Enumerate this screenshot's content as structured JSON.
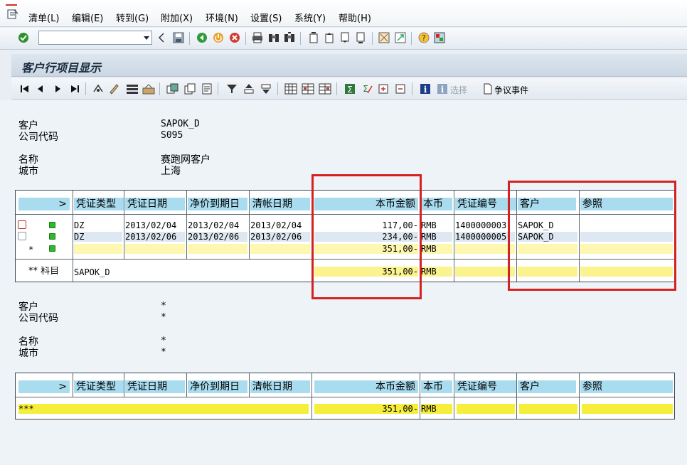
{
  "menu": {
    "items": [
      "清单(L)",
      "编辑(E)",
      "转到(G)",
      "附加(X)",
      "环境(N)",
      "设置(S)",
      "系统(Y)",
      "帮助(H)"
    ]
  },
  "title": "客户行项目显示",
  "app_toolbar": {
    "select_label": "选择",
    "dispute_label": "争议事件"
  },
  "header1": {
    "customer_label": "客户",
    "customer_value": "SAPOK_D",
    "company_label": "公司代码",
    "company_value": "S095",
    "name_label": "名称",
    "name_value": "赛跑网客户",
    "city_label": "城市",
    "city_value": "上海"
  },
  "header2": {
    "customer_label": "客户",
    "customer_value": "*",
    "company_label": "公司代码",
    "company_value": "*",
    "name_label": "名称",
    "name_value": "*",
    "city_label": "城市",
    "city_value": "*"
  },
  "columns": {
    "expand": ">",
    "doc_type": "凭证类型",
    "doc_date": "凭证日期",
    "net_due": "净价到期日",
    "clear_date": "清帐日期",
    "amount": "本币金额",
    "currency": "本币",
    "doc_no": "凭证编号",
    "customer": "客户",
    "reference": "参照"
  },
  "grid1": {
    "rows": [
      {
        "doc_type": "DZ",
        "doc_date": "2013/02/04",
        "net_due": "2013/02/04",
        "clear_date": "2013/02/04",
        "amount": "117,00-",
        "currency": "RMB",
        "doc_no": "1400000003",
        "customer": "SAPOK_D",
        "reference": ""
      },
      {
        "doc_type": "DZ",
        "doc_date": "2013/02/06",
        "net_due": "2013/02/06",
        "clear_date": "2013/02/06",
        "amount": "234,00-",
        "currency": "RMB",
        "doc_no": "1400000005",
        "customer": "SAPOK_D",
        "reference": ""
      }
    ],
    "subtotal": {
      "marker": "*",
      "amount": "351,00-",
      "currency": "RMB"
    },
    "account_total": {
      "marker": "** 科目",
      "account": "SAPOK_D",
      "amount": "351,00-",
      "currency": "RMB"
    }
  },
  "grid2": {
    "grand_total": {
      "marker": "***",
      "amount": "351,00-",
      "currency": "RMB"
    }
  },
  "colors": {
    "header_cell": "#a9dcef",
    "subtotal_yellow": "#fdf7b0",
    "grand_total_yellow": "#f5ee3b",
    "status_green": "#2dbb2d",
    "annotation_red": "#d42222"
  }
}
